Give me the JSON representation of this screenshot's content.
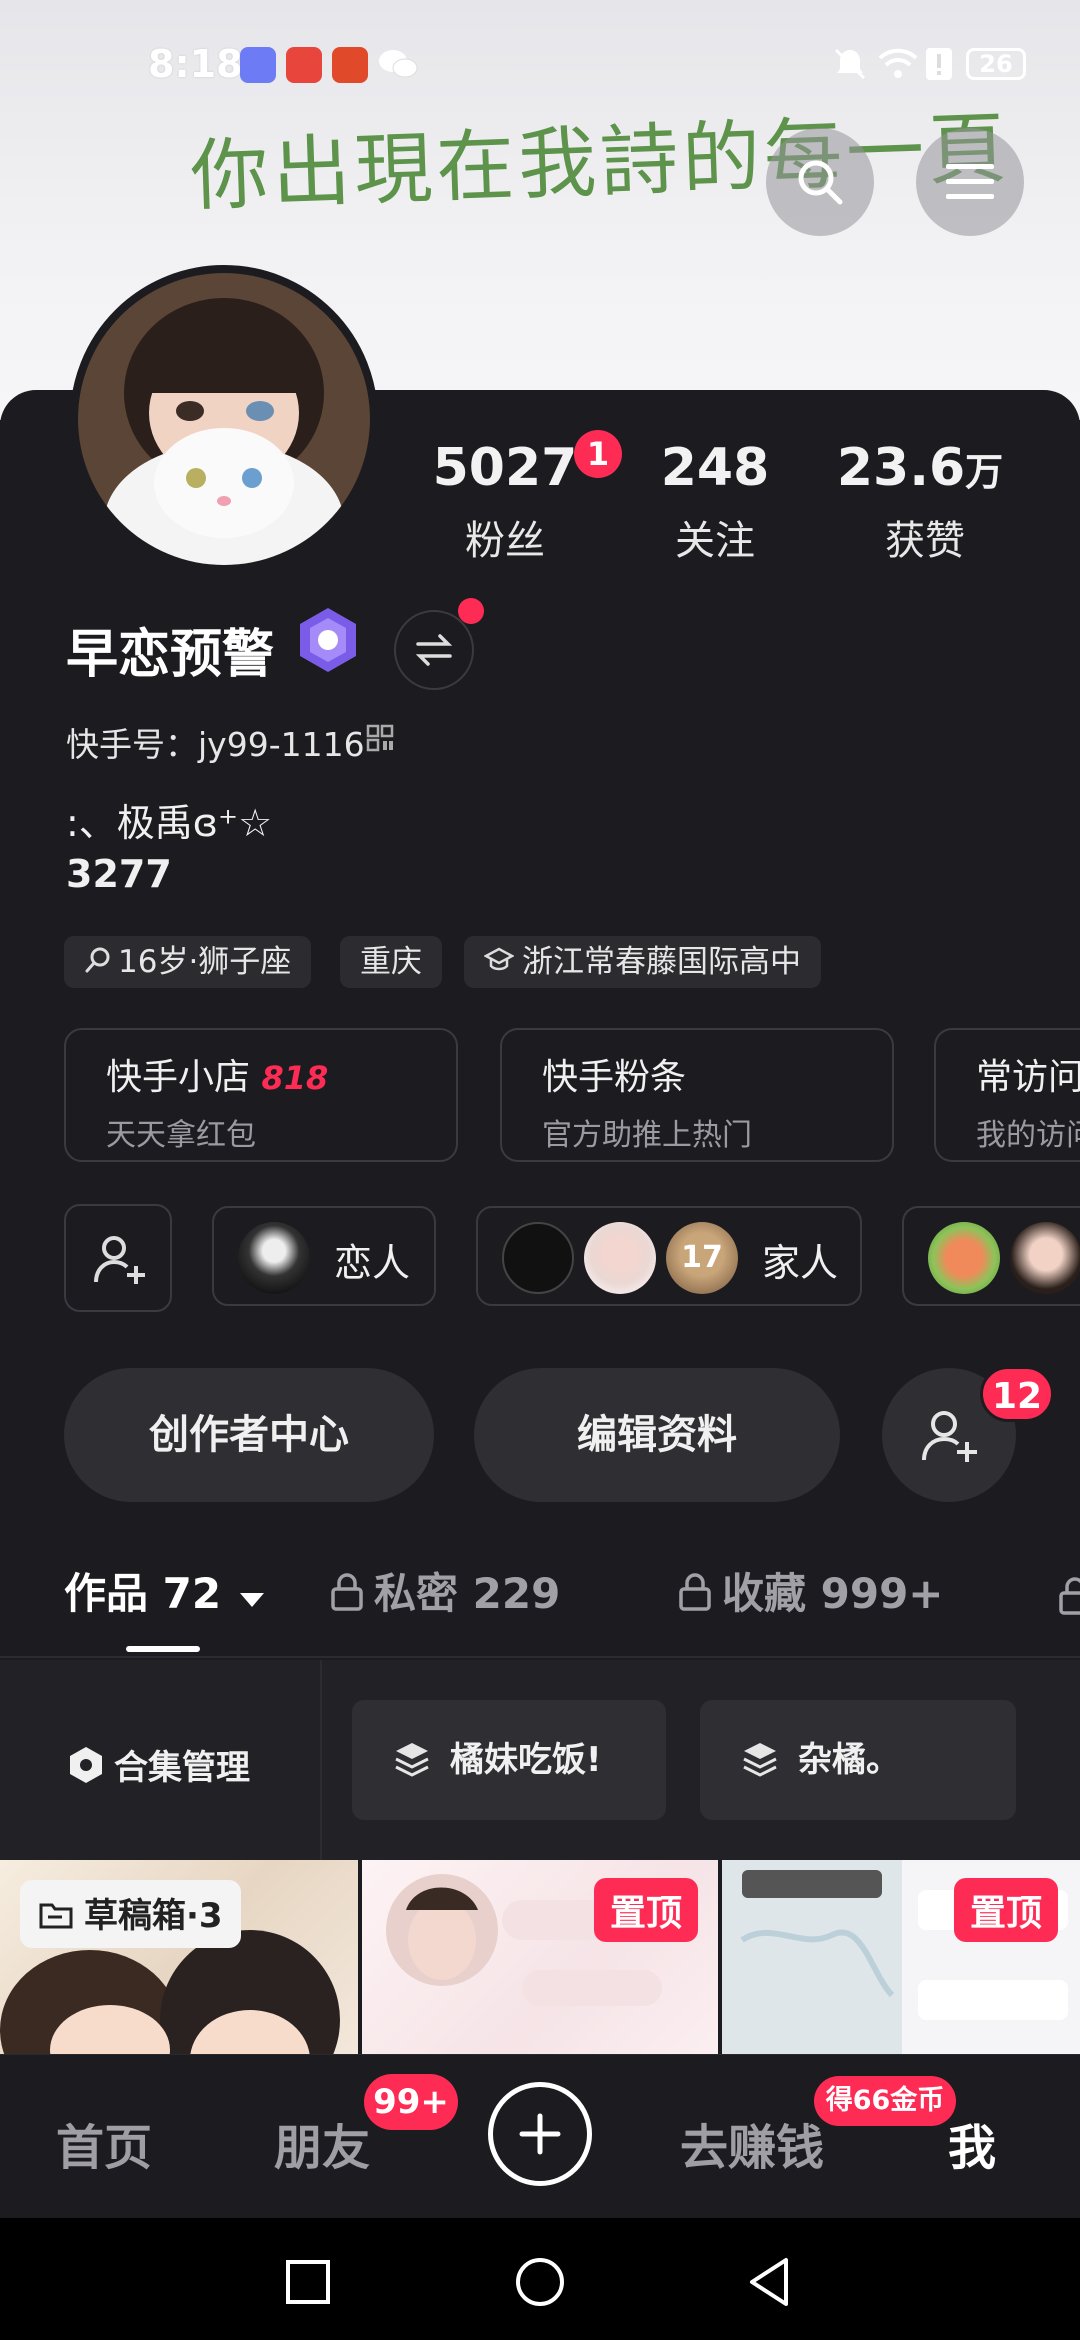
{
  "status_bar": {
    "time": "8:18",
    "battery": "26"
  },
  "header": {
    "handwriting": "你出現在我詩的每一頁"
  },
  "profile": {
    "stats": [
      {
        "value": "5027",
        "label": "粉丝",
        "badge": "1"
      },
      {
        "value": "248",
        "label": "关注"
      },
      {
        "value": "23.6",
        "unit": "万",
        "label": "获赞"
      }
    ],
    "name": "早恋预警",
    "id_label": "快手号：jy99-1116",
    "bio_line1": ":、极禹ɞ⁺☆",
    "bio_line2": "3277",
    "tags": [
      {
        "icon": "search-icon",
        "text": "16岁·狮子座"
      },
      {
        "icon": "",
        "text": "重庆"
      },
      {
        "icon": "school-icon",
        "text": "浙江常春藤国际高中"
      }
    ]
  },
  "services": [
    {
      "title": "快手小店",
      "promo": "818",
      "subtitle": "天天拿红包"
    },
    {
      "title": "快手粉条",
      "subtitle": "官方助推上热门"
    },
    {
      "title": "常访问",
      "subtitle": "我的访问"
    }
  ],
  "relations": [
    {
      "label": "恋人"
    },
    {
      "label": "家人",
      "count": "17"
    }
  ],
  "actions": {
    "creator_center": "创作者中心",
    "edit_profile": "编辑资料",
    "add_friend_badge": "12"
  },
  "tabs": [
    {
      "label": "作品 72",
      "active": true
    },
    {
      "label": "私密 229",
      "locked": true
    },
    {
      "label": "收藏 999+",
      "locked": true
    }
  ],
  "collections": {
    "manage": "合集管理",
    "items": [
      "橘妹吃饭!",
      "杂橘。"
    ]
  },
  "grid": {
    "drafts": "草稿箱·3",
    "pin_label": "置顶"
  },
  "bottom_nav": {
    "home": "首页",
    "friends": "朋友",
    "friends_badge": "99+",
    "earn": "去赚钱",
    "earn_badge": "得66金币",
    "me": "我"
  },
  "colors": {
    "accent": "#fe2c55",
    "background": "#1c1c20",
    "header_bg": "#ececef"
  }
}
